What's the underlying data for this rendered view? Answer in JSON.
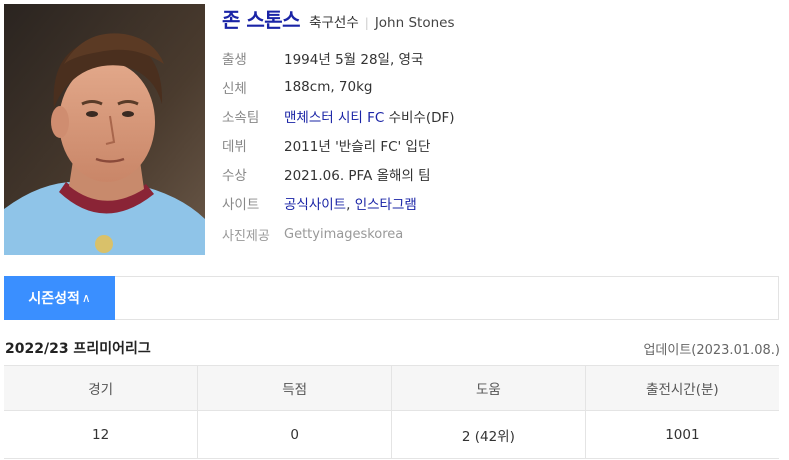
{
  "player": {
    "name": "존 스톤스",
    "occupation": "축구선수",
    "separator": "|",
    "english_name": "John Stones",
    "photo_icon": "player-photo"
  },
  "details": [
    {
      "label": "출생",
      "value": "1994년 5월 28일, 영국"
    },
    {
      "label": "신체",
      "value": "188cm, 70kg"
    },
    {
      "label": "소속팀",
      "value_link": "맨체스터 시티 FC",
      "value_rest": " 수비수(DF)"
    },
    {
      "label": "데뷔",
      "value": "2011년 '반슬리 FC' 입단"
    },
    {
      "label": "수상",
      "value": "2021.06. PFA 올해의 팀"
    },
    {
      "label": "사이트",
      "link1": "공식사이트",
      "comma": ", ",
      "link2": "인스타그램"
    }
  ],
  "credit": {
    "label": "사진제공",
    "value": "Gettyimageskorea"
  },
  "season": {
    "tab_label": "시즌성적",
    "tab_icon": "chevron-up-icon",
    "tab_chevron": "∧",
    "league": "2022/23 프리미어리그",
    "update": "업데이트(2023.01.08.)"
  },
  "stats_table": {
    "headers": [
      "경기",
      "득점",
      "도움",
      "출전시간(분)"
    ],
    "row": [
      "12",
      "0",
      "2 (42위)",
      "1001"
    ]
  },
  "colors": {
    "accent_blue": "#3a8fff",
    "link_navy": "#1a24a6"
  }
}
